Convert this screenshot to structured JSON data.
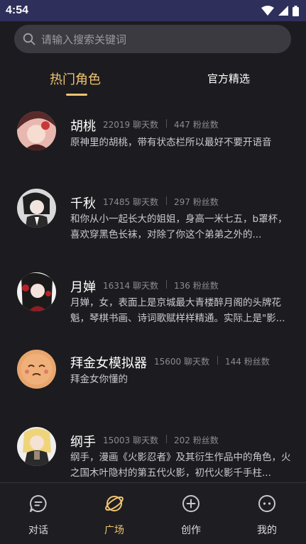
{
  "status_bar": {
    "time": "4:54"
  },
  "search": {
    "placeholder": "请输入搜索关键词"
  },
  "tabs": [
    {
      "label": "热门角色"
    },
    {
      "label": "官方精选"
    }
  ],
  "characters": [
    {
      "name": "胡桃",
      "chats": "22019 聊天数",
      "fans": "447 粉丝数",
      "desc": "原神里的胡桃，带有状态栏所以最好不要开语音"
    },
    {
      "name": "千秋",
      "chats": "17485 聊天数",
      "fans": "297 粉丝数",
      "desc": "和你从小一起长大的姐姐，身高一米七五，b罩杯，喜欢穿黑色长袜，对除了你这个弟弟之外的..."
    },
    {
      "name": "月婵",
      "chats": "16314 聊天数",
      "fans": "136 粉丝数",
      "desc": "月婵，女，表面上是京城最大青楼醉月阁的头牌花魁，琴棋书画、诗词歌赋样样精通。实际上是\"影..."
    },
    {
      "name": "拜金女模拟器",
      "chats": "15600 聊天数",
      "fans": "144 粉丝数",
      "desc": "拜金女你懂的"
    },
    {
      "name": "纲手",
      "chats": "15003 聊天数",
      "fans": "202 粉丝数",
      "desc": "纲手，漫画《火影忍者》及其衍生作品中的角色，火之国木叶隐村的第五代火影，初代火影千手柱..."
    }
  ],
  "bottom_nav": [
    {
      "label": "对话",
      "icon": "chat-bubble-icon"
    },
    {
      "label": "广场",
      "icon": "planet-icon"
    },
    {
      "label": "创作",
      "icon": "plus-circle-icon"
    },
    {
      "label": "我的",
      "icon": "profile-face-icon"
    }
  ],
  "colors": {
    "accent": "#f1c470",
    "background": "#1c1c20",
    "statusbar": "#2f2f5b"
  }
}
